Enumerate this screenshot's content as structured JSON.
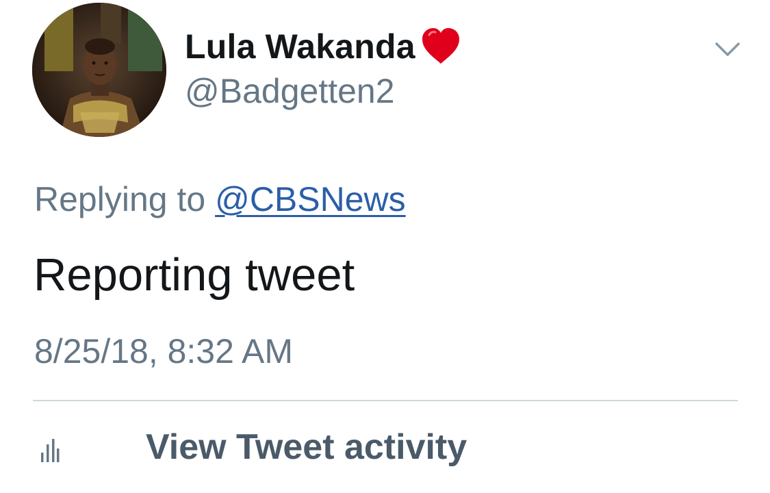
{
  "tweet": {
    "author": {
      "display_name": "Lula Wakanda",
      "name_emoji": "heart-icon",
      "handle": "@Badgetten2",
      "avatar": "profile-photo"
    },
    "menu_icon": "chevron-down-icon",
    "reply": {
      "prefix": "Replying to",
      "target": "@CBSNews"
    },
    "text": "Reporting tweet",
    "timestamp": "8/25/18, 8:32 AM",
    "activity": {
      "icon": "bar-chart-icon",
      "label": "View Tweet activity"
    },
    "colors": {
      "text": "#14171a",
      "secondary": "#657786",
      "link": "#2b5ea8",
      "heart": "#e0001b",
      "divider": "#ccd6dd"
    }
  }
}
